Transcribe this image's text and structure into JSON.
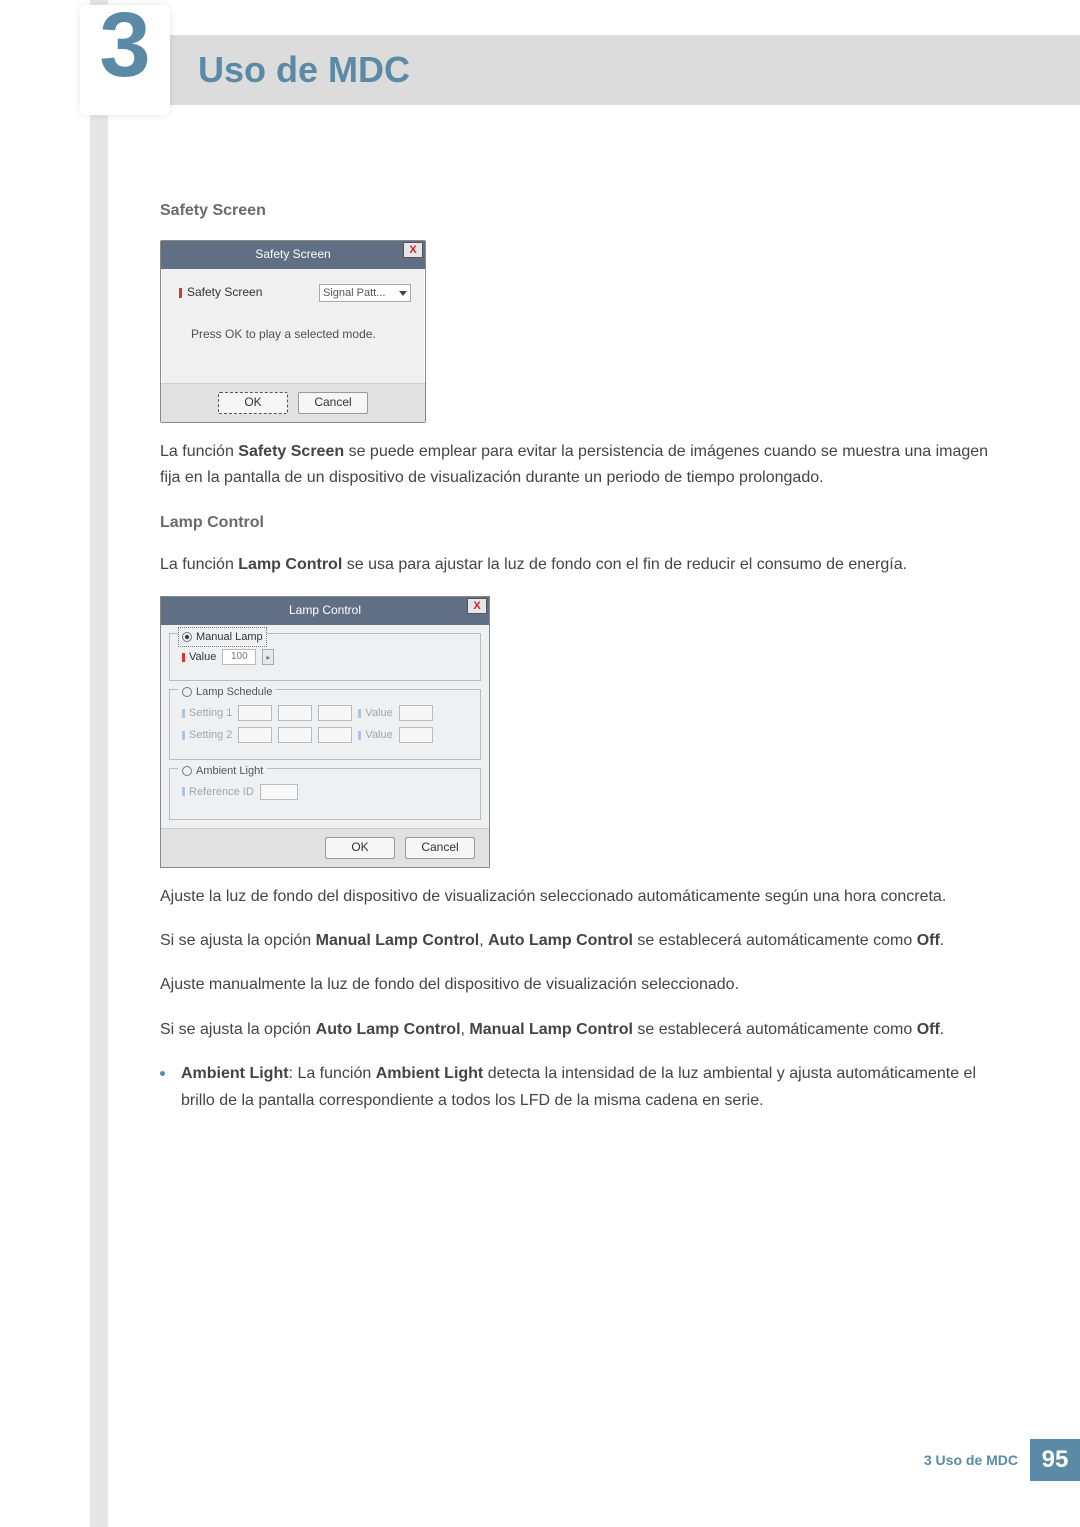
{
  "header": {
    "title": "Uso de MDC",
    "chapter_num": "3"
  },
  "section1": {
    "heading": "Safety Screen",
    "dialog": {
      "title": "Safety Screen",
      "close": "X",
      "label": "Safety Screen",
      "dropdown": "Signal Patt...",
      "message": "Press OK to play a selected mode.",
      "ok": "OK",
      "cancel": "Cancel"
    },
    "para_pre": "La función ",
    "para_bold": "Safety Screen",
    "para_post": " se puede emplear para evitar la persistencia de imágenes cuando se muestra una imagen fija en la pantalla de un dispositivo de visualización durante un periodo de tiempo prolongado."
  },
  "section2": {
    "heading": "Lamp Control",
    "intro_pre": "La función ",
    "intro_bold": "Lamp Control",
    "intro_post": " se usa para ajustar la luz de fondo con el fin de reducir el consumo de energía.",
    "dialog": {
      "title": "Lamp Control",
      "close": "X",
      "manual_lamp": "Manual Lamp",
      "value_label": "Value",
      "value": "100",
      "slider_arrow": "▸",
      "lamp_schedule": "Lamp Schedule",
      "setting1": "Setting 1",
      "setting2": "Setting 2",
      "value_disabled": "Value",
      "ambient_light": "Ambient Light",
      "reference_id": "Reference ID",
      "ok": "OK",
      "cancel": "Cancel"
    },
    "p1": "Ajuste la luz de fondo del dispositivo de visualización seleccionado automáticamente según una hora concreta.",
    "p2_pre": "Si se ajusta la opción ",
    "p2_b1": "Manual Lamp Control",
    "p2_mid": ", ",
    "p2_b2": "Auto Lamp Control",
    "p2_post": " se establecerá automáticamente como ",
    "p2_off": "Off",
    "p2_end": ".",
    "p3": "Ajuste manualmente la luz de fondo del dispositivo de visualización seleccionado.",
    "p4_pre": "Si se ajusta la opción ",
    "p4_b1": "Auto Lamp Control",
    "p4_mid": ", ",
    "p4_b2": "Manual Lamp Control",
    "p4_post": " se establecerá automáticamente como ",
    "p4_off": "Off",
    "p4_end": ".",
    "bullet_b1": "Ambient Light",
    "bullet_mid": ": La función ",
    "bullet_b2": "Ambient Light",
    "bullet_post": " detecta la intensidad de la luz ambiental y ajusta automáticamente el brillo de la pantalla correspondiente a todos los LFD de la misma cadena en serie."
  },
  "footer": {
    "text": "3 Uso de MDC",
    "page": "95"
  }
}
